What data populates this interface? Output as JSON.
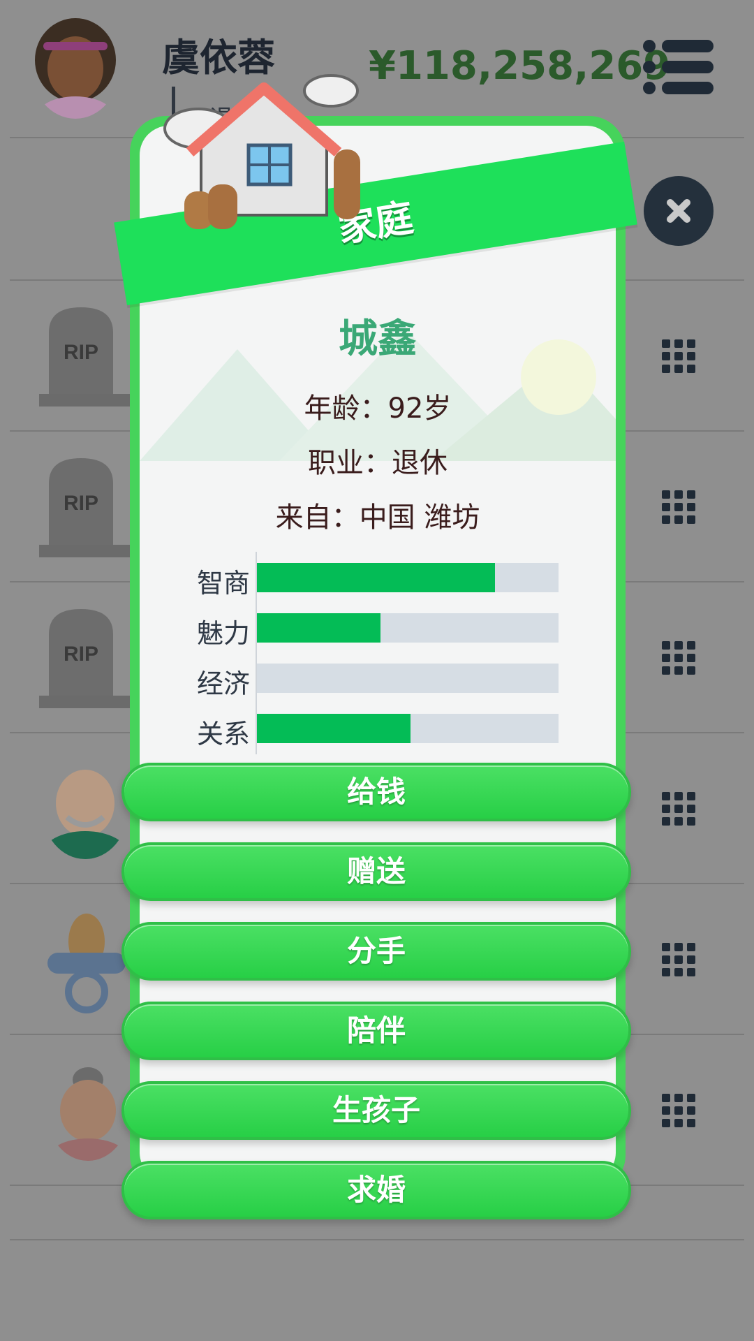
{
  "header": {
    "player_name": "虞依蓉",
    "player_job_partial": "退休",
    "money": "¥118,258,269"
  },
  "dialog": {
    "title": "家庭",
    "person_name": "城鑫",
    "age_line": "年龄：92岁",
    "job_line": "职业：退休",
    "from_line": "来自：中国 潍坊",
    "stats": [
      {
        "label": "智商",
        "value": 0.79
      },
      {
        "label": "魅力",
        "value": 0.41
      },
      {
        "label": "经济",
        "value": 0.0
      },
      {
        "label": "关系",
        "value": 0.51
      }
    ],
    "actions": [
      "给钱",
      "赠送",
      "分手",
      "陪伴",
      "生孩子",
      "求婚"
    ]
  },
  "background_list": {
    "tomb_text": "RIP"
  },
  "colors": {
    "overlay": "#8f8f8f",
    "dialog_border": "#46d35b",
    "ribbon": "#1ee05a",
    "stat_fill": "#04bc56",
    "stat_track": "#d6dde4",
    "name_color": "#3aa876"
  },
  "icons": [
    "hamburger-menu-icon",
    "close-icon",
    "grid-menu-icon",
    "tombstone-icon",
    "house-icon",
    "pacifier-icon"
  ]
}
